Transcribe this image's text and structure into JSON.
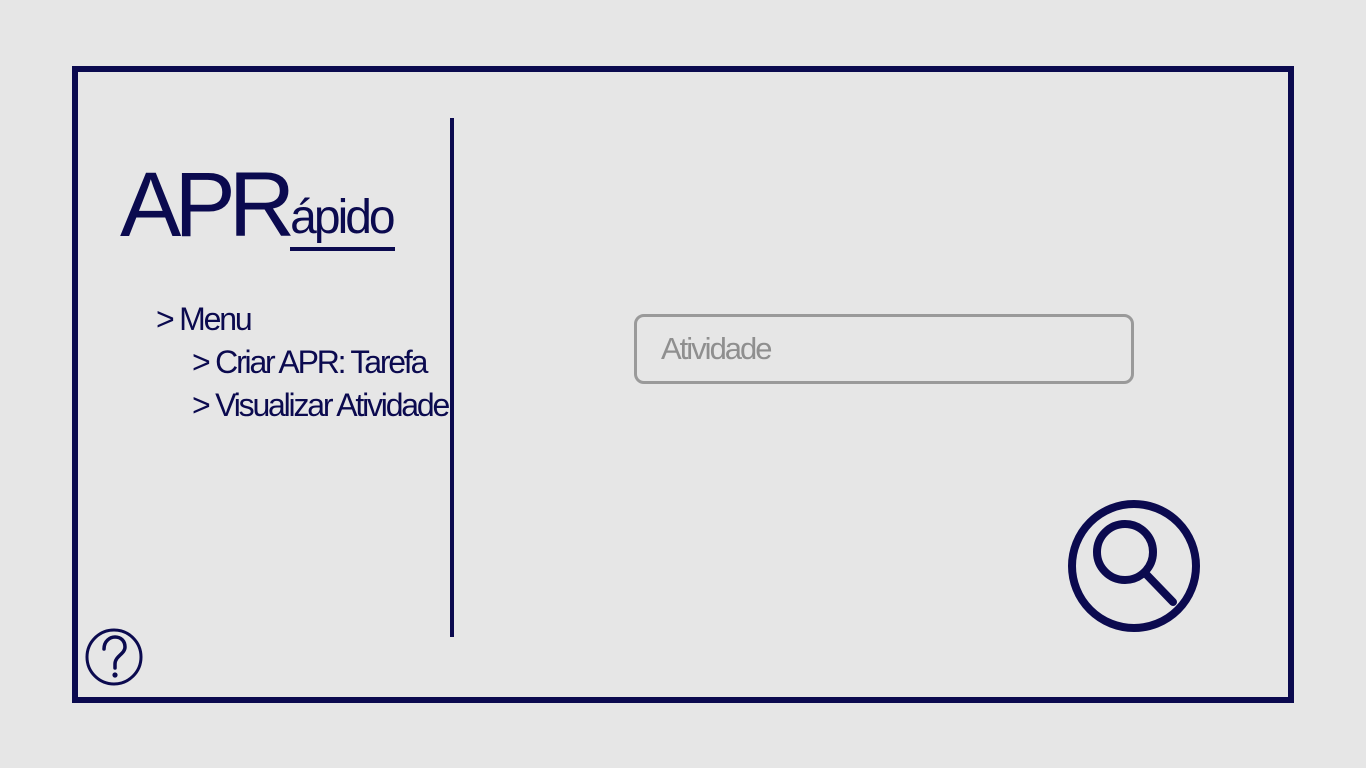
{
  "logo": {
    "big": "APR",
    "small": "ápido"
  },
  "menu": {
    "title": "> Menu",
    "items": [
      {
        "label": "> Criar APR: Tarefa"
      },
      {
        "label": "> Visualizar Atividade"
      }
    ]
  },
  "search": {
    "placeholder": "Atividade",
    "button_icon": "search-icon"
  },
  "help": {
    "icon": "question-circle-icon"
  },
  "colors": {
    "accent": "#0b0a4f",
    "background": "#e6e6e6",
    "input_border": "#9a9a9a",
    "placeholder": "#8f8f8f"
  }
}
